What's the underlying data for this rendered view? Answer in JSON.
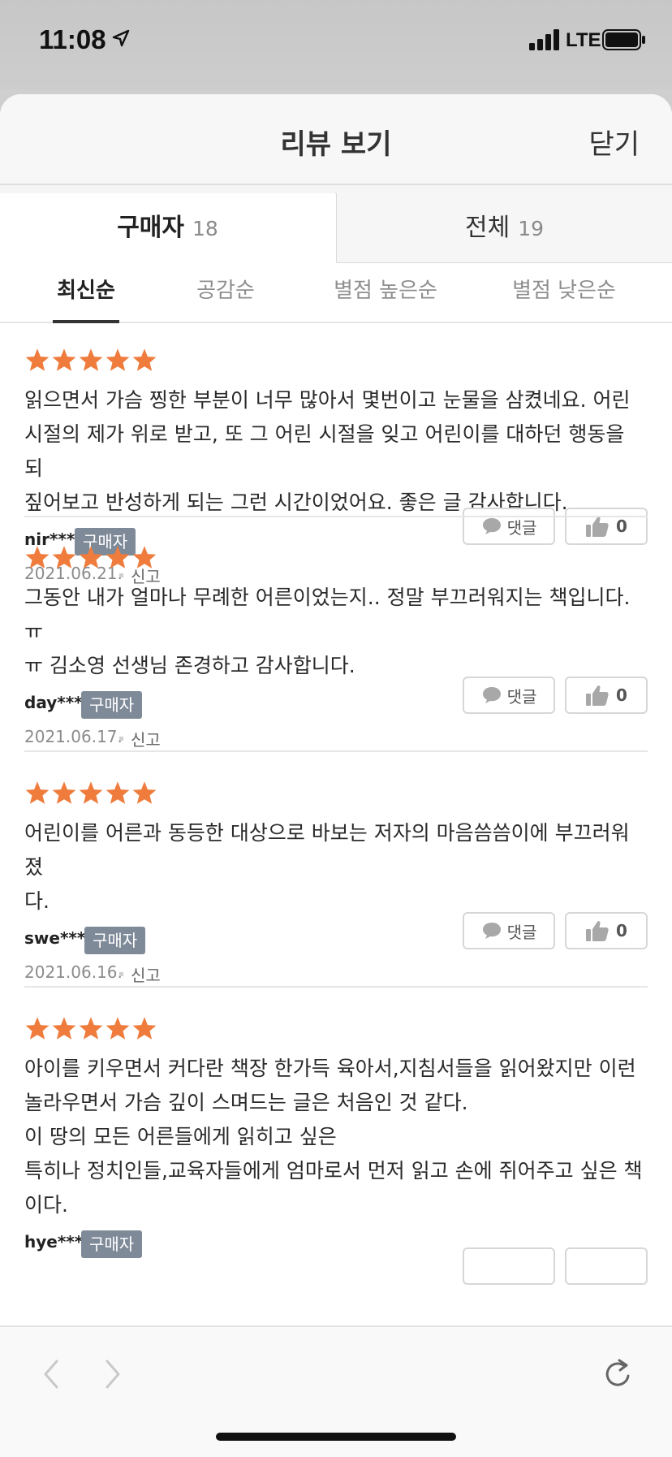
{
  "status_bar": {
    "time": "11:08",
    "network": "LTE"
  },
  "sheet": {
    "title": "리뷰 보기",
    "close_label": "닫기"
  },
  "tabs": [
    {
      "label": "구매자",
      "count": "18",
      "active": true
    },
    {
      "label": "전체",
      "count": "19",
      "active": false
    }
  ],
  "sort_options": [
    {
      "label": "최신순",
      "active": true
    },
    {
      "label": "공감순",
      "active": false
    },
    {
      "label": "별점 높은순",
      "active": false
    },
    {
      "label": "별점 낮은순",
      "active": false
    }
  ],
  "reviews": [
    {
      "rating": 5,
      "text": "읽으면서 가슴 찡한 부분이 너무 많아서 몇번이고 눈물을 삼켰네요. 어린\n시절의 제가 위로 받고, 또 그 어린 시절을 잊고 어린이를 대하던 행동을 되\n짚어보고 반성하게 되는 그런 시간이었어요. 좋은 글 감사합니다.",
      "reviewer": "nir***",
      "badge": "구매자",
      "date": "2021.06.21.",
      "report": "신고",
      "comment_label": "댓글",
      "likes": "0"
    },
    {
      "rating": 5,
      "text": "그동안 내가 얼마나 무례한 어른이었는지.. 정말 부끄러워지는 책입니다.ㅠ\nㅠ 김소영 선생님 존경하고 감사합니다.",
      "reviewer": "day***",
      "badge": "구매자",
      "date": "2021.06.17.",
      "report": "신고",
      "comment_label": "댓글",
      "likes": "0"
    },
    {
      "rating": 5,
      "text": "어린이를 어른과 동등한 대상으로 바보는 저자의 마음씀씀이에 부끄러워졌\n다.",
      "reviewer": "swe***",
      "badge": "구매자",
      "date": "2021.06.16.",
      "report": "신고",
      "comment_label": "댓글",
      "likes": "0"
    },
    {
      "rating": 5,
      "text": "아이를 키우면서 커다란 책장 한가득 육아서,지침서들을 읽어왔지만 이런\n놀라우면서 가슴 깊이 스며드는 글은 처음인 것 같다.\n이 땅의 모든 어른들에게 읽히고 싶은\n특히나 정치인들,교육자들에게 엄마로서 먼저 읽고 손에 쥐어주고 싶은 책\n이다.",
      "reviewer": "hye***",
      "badge": "구매자"
    }
  ],
  "colors": {
    "star": "#ef7c3c",
    "badge": "#7f8a99"
  }
}
